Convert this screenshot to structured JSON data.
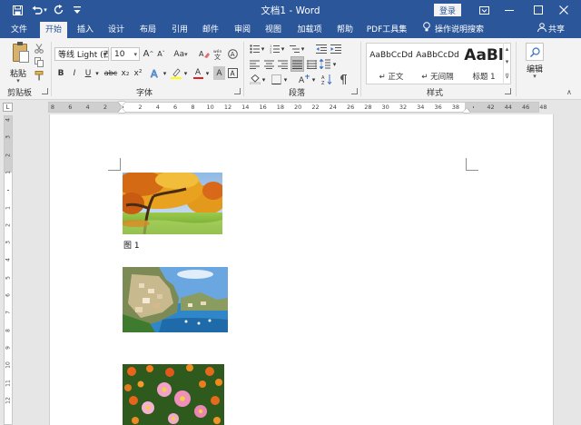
{
  "titlebar": {
    "title": "文档1  -  Word",
    "login_label": "登录",
    "qat": [
      "save-icon",
      "undo-icon",
      "redo-icon",
      "customize-qat-icon"
    ],
    "window_buttons": [
      "ribbon-display-options-icon",
      "minimize-icon",
      "maximize-icon",
      "close-icon"
    ]
  },
  "tabs": [
    {
      "label": "文件",
      "active": false
    },
    {
      "label": "开始",
      "active": true
    },
    {
      "label": "插入",
      "active": false
    },
    {
      "label": "设计",
      "active": false
    },
    {
      "label": "布局",
      "active": false
    },
    {
      "label": "引用",
      "active": false
    },
    {
      "label": "邮件",
      "active": false
    },
    {
      "label": "审阅",
      "active": false
    },
    {
      "label": "视图",
      "active": false
    },
    {
      "label": "加载项",
      "active": false
    },
    {
      "label": "帮助",
      "active": false
    },
    {
      "label": "PDF工具集",
      "active": false
    }
  ],
  "tell_me": {
    "label": "操作说明搜索",
    "icon": "lightbulb-icon"
  },
  "share": {
    "label": "共享",
    "icon": "person-icon"
  },
  "ribbon": {
    "clipboard": {
      "label": "剪贴板",
      "paste_label": "粘贴",
      "tools": [
        "cut-icon",
        "copy-icon",
        "format-painter-icon"
      ]
    },
    "font": {
      "label": "字体",
      "font_name": "等线 Light (西",
      "font_size": "10",
      "grow_label": "A",
      "shrink_label": "A",
      "case_label": "Aa",
      "bold_label": "B",
      "italic_label": "I",
      "underline_label": "U",
      "strike_label": "abc",
      "subscript_label": "x₂",
      "superscript_label": "x²",
      "font_color_label": "A",
      "char_shading_label": "A"
    },
    "paragraph": {
      "label": "段落"
    },
    "styles": {
      "label": "样式",
      "items": [
        {
          "sample": "AaBbCcDd",
          "name": "↵ 正文"
        },
        {
          "sample": "AaBbCcDd",
          "name": "↵ 无间隔"
        },
        {
          "sample": "AaBl",
          "name": "标题 1"
        }
      ]
    },
    "editing": {
      "label": "编辑"
    }
  },
  "ruler": {
    "corner_label": "L",
    "labels": [
      "8",
      "6",
      "4",
      "2",
      "",
      "2",
      "4",
      "6",
      "8",
      "10",
      "12",
      "14",
      "16",
      "18",
      "20",
      "22",
      "24",
      "26",
      "28",
      "30",
      "32",
      "34",
      "36",
      "38",
      "",
      "42",
      "44",
      "46",
      "48"
    ],
    "vlabels": [
      "4",
      "3",
      "2",
      "1",
      "",
      "1",
      "2",
      "3",
      "4",
      "5",
      "6",
      "7",
      "8",
      "9",
      "10",
      "11",
      "12"
    ]
  },
  "document": {
    "caption": "图 1",
    "images": [
      "autumn-park-photo",
      "coastal-village-photo",
      "pink-flowers-photo"
    ]
  },
  "colors": {
    "brand_blue": "#2b579a",
    "ribbon_bg": "#f3f3f3",
    "workspace_bg": "#e6e6e6"
  }
}
